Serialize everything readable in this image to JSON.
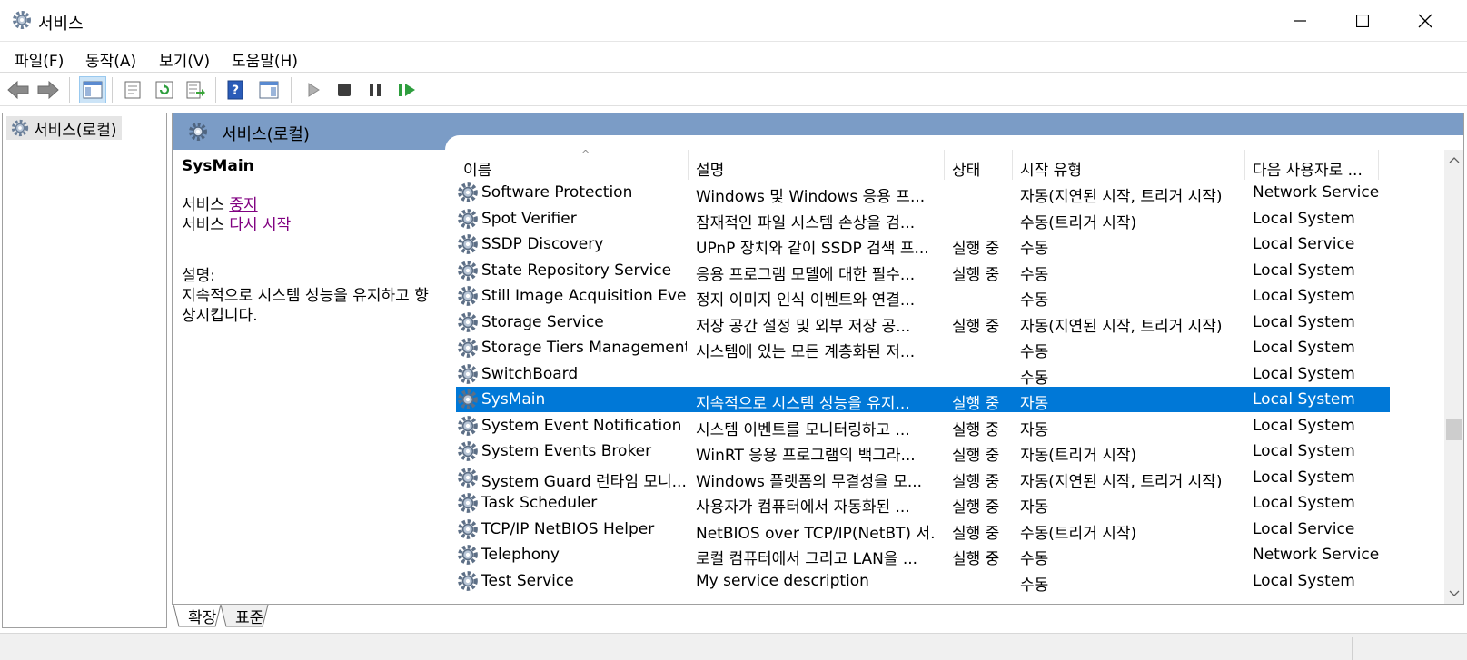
{
  "window": {
    "title": "서비스",
    "icon": "gear-icon"
  },
  "menu": [
    "파일(F)",
    "동작(A)",
    "보기(V)",
    "도움말(H)"
  ],
  "toolbar": [
    "back-arrow-icon",
    "forward-arrow-icon",
    "show-hide-console-tree-icon",
    "properties-icon",
    "refresh-icon",
    "export-list-icon",
    "help-icon",
    "action-pane-icon",
    "start-service-icon",
    "stop-service-icon",
    "pause-service-icon",
    "restart-service-icon"
  ],
  "tree": {
    "root": "서비스(로컬)"
  },
  "main": {
    "header": "서비스(로컬)"
  },
  "details": {
    "service_name": "SysMain",
    "stop_prefix": "서비스 ",
    "stop_link": "중지",
    "restart_prefix": "서비스 ",
    "restart_link": "다시 시작",
    "desc_label": "설명:",
    "desc_text": "지속적으로 시스템 성능을 유지하고 향상시킵니다."
  },
  "columns": [
    "이름",
    "설명",
    "상태",
    "시작 유형",
    "다음 사용자로 ..."
  ],
  "services": [
    {
      "name": "Software Protection",
      "desc": "Windows 및 Windows 응용 프...",
      "status": "",
      "startup": "자동(지연된 시작, 트리거 시작)",
      "logon": "Network Service"
    },
    {
      "name": "Spot Verifier",
      "desc": "잠재적인 파일 시스템 손상을 검...",
      "status": "",
      "startup": "수동(트리거 시작)",
      "logon": "Local System"
    },
    {
      "name": "SSDP Discovery",
      "desc": "UPnP 장치와 같이 SSDP 검색 프...",
      "status": "실행 중",
      "startup": "수동",
      "logon": "Local Service"
    },
    {
      "name": "State Repository Service",
      "desc": "응용 프로그램 모델에 대한 필수...",
      "status": "실행 중",
      "startup": "수동",
      "logon": "Local System"
    },
    {
      "name": "Still Image Acquisition Events",
      "desc": "정지 이미지 인식 이벤트와 연결...",
      "status": "",
      "startup": "수동",
      "logon": "Local System"
    },
    {
      "name": "Storage Service",
      "desc": "저장 공간 설정 및 외부 저장 공...",
      "status": "실행 중",
      "startup": "자동(지연된 시작, 트리거 시작)",
      "logon": "Local System"
    },
    {
      "name": "Storage Tiers Management",
      "desc": "시스템에 있는 모든 계층화된 저...",
      "status": "",
      "startup": "수동",
      "logon": "Local System"
    },
    {
      "name": "SwitchBoard",
      "desc": "",
      "status": "",
      "startup": "수동",
      "logon": "Local System"
    },
    {
      "name": "SysMain",
      "desc": "지속적으로 시스템 성능을 유지...",
      "status": "실행 중",
      "startup": "자동",
      "logon": "Local System",
      "selected": true
    },
    {
      "name": "System Event Notification S...",
      "desc": "시스템 이벤트를 모니터링하고 ...",
      "status": "실행 중",
      "startup": "자동",
      "logon": "Local System"
    },
    {
      "name": "System Events Broker",
      "desc": "WinRT 응용 프로그램의 백그라...",
      "status": "실행 중",
      "startup": "자동(트리거 시작)",
      "logon": "Local System"
    },
    {
      "name": "System Guard 런타임 모니...",
      "desc": "Windows 플랫폼의 무결성을 모...",
      "status": "실행 중",
      "startup": "자동(지연된 시작, 트리거 시작)",
      "logon": "Local System"
    },
    {
      "name": "Task Scheduler",
      "desc": "사용자가 컴퓨터에서 자동화된 ...",
      "status": "실행 중",
      "startup": "자동",
      "logon": "Local System"
    },
    {
      "name": "TCP/IP NetBIOS Helper",
      "desc": "NetBIOS over TCP/IP(NetBT) 서...",
      "status": "실행 중",
      "startup": "수동(트리거 시작)",
      "logon": "Local Service"
    },
    {
      "name": "Telephony",
      "desc": "로컬 컴퓨터에서 그리고 LAN을 ...",
      "status": "실행 중",
      "startup": "수동",
      "logon": "Network Service"
    },
    {
      "name": "Test Service",
      "desc": "My service description",
      "status": "",
      "startup": "수동",
      "logon": "Local System"
    }
  ],
  "tabs": [
    "확장",
    "표준"
  ],
  "colors": {
    "selection": "#0078d7",
    "header_band": "#7b9cc6",
    "link": "#800080"
  }
}
